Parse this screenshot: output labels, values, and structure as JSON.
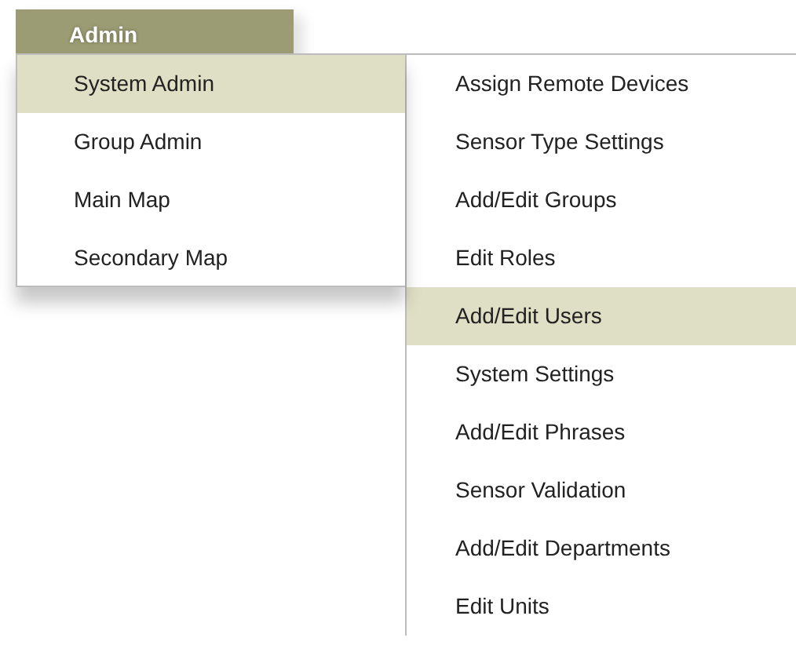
{
  "menu_bar": {
    "label": "Admin",
    "selected": true
  },
  "menu": {
    "items": [
      {
        "label": "System Admin",
        "selected": true
      },
      {
        "label": "Group Admin",
        "selected": false
      },
      {
        "label": "Main Map",
        "selected": false
      },
      {
        "label": "Secondary Map",
        "selected": false
      }
    ]
  },
  "submenu": {
    "items": [
      {
        "label": "Assign Remote Devices",
        "selected": false
      },
      {
        "label": "Sensor Type Settings",
        "selected": false
      },
      {
        "label": "Add/Edit Groups",
        "selected": false
      },
      {
        "label": "Edit Roles",
        "selected": false
      },
      {
        "label": "Add/Edit Users",
        "selected": true
      },
      {
        "label": "System Settings",
        "selected": false
      },
      {
        "label": "Add/Edit Phrases",
        "selected": false
      },
      {
        "label": "Sensor Validation",
        "selected": false
      },
      {
        "label": "Add/Edit Departments",
        "selected": false
      },
      {
        "label": "Edit Units",
        "selected": false
      }
    ]
  }
}
